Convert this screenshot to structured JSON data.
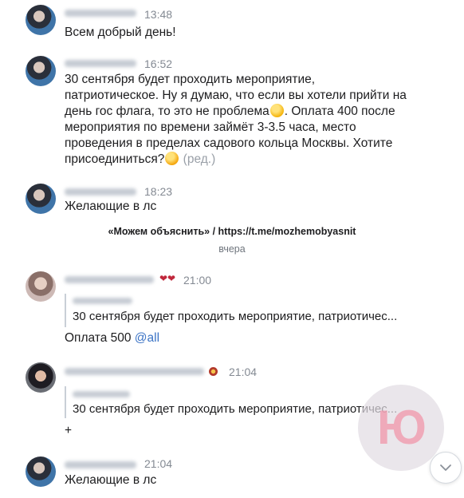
{
  "messages": [
    {
      "time": "13:48",
      "text": "Всем добрый день!"
    },
    {
      "time": "16:52",
      "lines": [
        "30 сентября будет проходить мероприятие,",
        "патриотическое. Ну я думаю, что если вы хотели прийти на",
        "день гос флага, то это не проблема",
        ". Оплата 400 после",
        "мероприятия по времени займёт 3-3.5 часа, место",
        "проведения в пределах садового кольца Москвы. Хотите",
        "присоединиться?"
      ],
      "edited": "(ред.)"
    },
    {
      "time": "18:23",
      "text": "Желающие в лс"
    },
    {
      "time": "21:00",
      "quote": "30 сентября будет проходить мероприятие, патриотичес...",
      "text_prefix": "Оплата 500 ",
      "mention": "@all"
    },
    {
      "time": "21:04",
      "quote": "30 сентября будет проходить мероприятие, патриотичес...",
      "text": "+"
    },
    {
      "time": "21:04",
      "text": "Желающие в лс"
    }
  ],
  "service": {
    "text": "«Можем объяснить» / https://t.me/mozhemobyasnit"
  },
  "date_separator": "вчера",
  "logo": {
    "text": "Ю",
    "color": "#f096aa"
  },
  "icons": {
    "scroll_down": "chevron-down-icon",
    "smile_1": "slightly-smiling-emoji-icon",
    "smile_2": "grinning-emoji-icon",
    "heart": "heart-icon",
    "badge": "badge-icon"
  }
}
